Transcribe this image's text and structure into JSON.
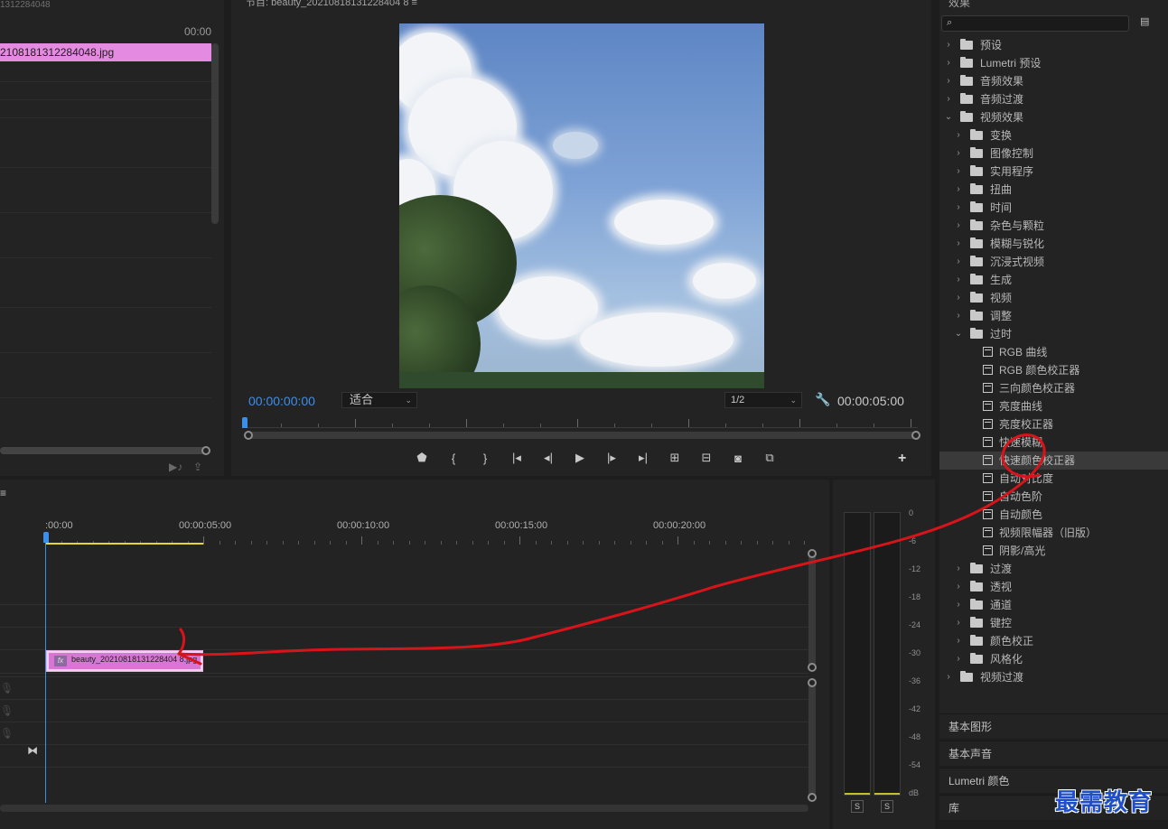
{
  "project": {
    "top_text": "1312284048",
    "timecode": "00:00",
    "clip_name": "2108181312284048.jpg"
  },
  "program": {
    "title": "节目: beauty_20210818131228404 8 ≡",
    "current_time": "00:00:00:00",
    "fit": "适合",
    "resolution": "1/2",
    "duration": "00:00:05:00"
  },
  "timeline": {
    "menu": "≡",
    "timecodes": [
      ":00:00",
      "00:00:05:00",
      "00:00:10:00",
      "00:00:15:00",
      "00:00:20:00"
    ],
    "clip_name": "beauty_20210818131228404 8.jpg",
    "fx_label": "fx"
  },
  "meters": {
    "scale": [
      "0",
      "-6",
      "-12",
      "-18",
      "-24",
      "-30",
      "-36",
      "-42",
      "-48",
      "-54",
      "dB"
    ],
    "solo_left": "S",
    "solo_right": "S"
  },
  "effects": {
    "title": "效果",
    "search_placeholder": "",
    "tree": [
      {
        "label": "预设",
        "level": 0,
        "kind": "preset",
        "expanded": false
      },
      {
        "label": "Lumetri 预设",
        "level": 0,
        "kind": "preset",
        "expanded": false
      },
      {
        "label": "音频效果",
        "level": 0,
        "kind": "folder",
        "expanded": false
      },
      {
        "label": "音频过渡",
        "level": 0,
        "kind": "folder",
        "expanded": false
      },
      {
        "label": "视频效果",
        "level": 0,
        "kind": "folder",
        "expanded": true
      },
      {
        "label": "变换",
        "level": 1,
        "kind": "folder",
        "expanded": false
      },
      {
        "label": "图像控制",
        "level": 1,
        "kind": "folder",
        "expanded": false
      },
      {
        "label": "实用程序",
        "level": 1,
        "kind": "folder",
        "expanded": false
      },
      {
        "label": "扭曲",
        "level": 1,
        "kind": "folder",
        "expanded": false
      },
      {
        "label": "时间",
        "level": 1,
        "kind": "folder",
        "expanded": false
      },
      {
        "label": "杂色与颗粒",
        "level": 1,
        "kind": "folder",
        "expanded": false
      },
      {
        "label": "模糊与锐化",
        "level": 1,
        "kind": "folder",
        "expanded": false
      },
      {
        "label": "沉浸式视频",
        "level": 1,
        "kind": "folder",
        "expanded": false
      },
      {
        "label": "生成",
        "level": 1,
        "kind": "folder",
        "expanded": false
      },
      {
        "label": "视频",
        "level": 1,
        "kind": "folder",
        "expanded": false
      },
      {
        "label": "调整",
        "level": 1,
        "kind": "folder",
        "expanded": false
      },
      {
        "label": "过时",
        "level": 1,
        "kind": "folder",
        "expanded": true
      },
      {
        "label": "RGB 曲线",
        "level": 2,
        "kind": "effect"
      },
      {
        "label": "RGB 颜色校正器",
        "level": 2,
        "kind": "effect"
      },
      {
        "label": "三向颜色校正器",
        "level": 2,
        "kind": "effect"
      },
      {
        "label": "亮度曲线",
        "level": 2,
        "kind": "effect"
      },
      {
        "label": "亮度校正器",
        "level": 2,
        "kind": "effect"
      },
      {
        "label": "快速模糊",
        "level": 2,
        "kind": "effect"
      },
      {
        "label": "快速颜色校正器",
        "level": 2,
        "kind": "effect",
        "selected": true
      },
      {
        "label": "自动对比度",
        "level": 2,
        "kind": "effect"
      },
      {
        "label": "自动色阶",
        "level": 2,
        "kind": "effect"
      },
      {
        "label": "自动颜色",
        "level": 2,
        "kind": "effect"
      },
      {
        "label": "视频限幅器（旧版）",
        "level": 2,
        "kind": "effect"
      },
      {
        "label": "阴影/高光",
        "level": 2,
        "kind": "effect"
      },
      {
        "label": "过渡",
        "level": 1,
        "kind": "folder",
        "expanded": false
      },
      {
        "label": "透视",
        "level": 1,
        "kind": "folder",
        "expanded": false
      },
      {
        "label": "通道",
        "level": 1,
        "kind": "folder",
        "expanded": false
      },
      {
        "label": "键控",
        "level": 1,
        "kind": "folder",
        "expanded": false
      },
      {
        "label": "颜色校正",
        "level": 1,
        "kind": "folder",
        "expanded": false
      },
      {
        "label": "风格化",
        "level": 1,
        "kind": "folder",
        "expanded": false
      },
      {
        "label": "视频过渡",
        "level": 0,
        "kind": "folder",
        "expanded": false
      }
    ]
  },
  "bottom_panels": [
    "基本图形",
    "基本声音",
    "Lumetri 颜色",
    "库"
  ],
  "watermark": "最需教育",
  "colors": {
    "accent_blue": "#3d8ee8",
    "clip_pink": "#e48ae0",
    "annotation_red": "#d8141a",
    "watermark_blue": "#1f4ec8"
  }
}
